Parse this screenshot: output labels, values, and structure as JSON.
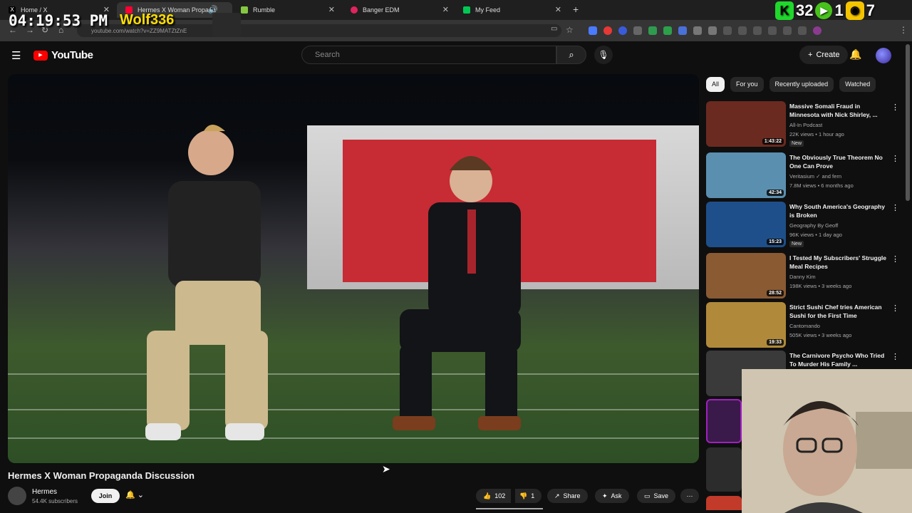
{
  "browser": {
    "tabs": [
      {
        "label": "Home / X",
        "color": "#000000",
        "glyph": "X"
      },
      {
        "label": "Hermes X Woman Propaga",
        "color": "#ff0033",
        "glyph": "▶"
      },
      {
        "label": "Rumble",
        "color": "#85c742",
        "glyph": "▶"
      },
      {
        "label": "Banger EDM",
        "color": "#e0245e",
        "glyph": "●"
      },
      {
        "label": "My Feed",
        "color": "#00c853",
        "glyph": "▶"
      }
    ],
    "url": "youtube.com/watch?v=ZZ9MATZtZnE"
  },
  "overlay": {
    "time": "04:19:53 PM",
    "username": "Wolf336",
    "kick_count": "32",
    "play_count": "1",
    "rumble_count": "7"
  },
  "header": {
    "logo_text": "YouTube",
    "search_placeholder": "Search",
    "create_label": "Create"
  },
  "video": {
    "title": "Hermes X Woman Propaganda Discussion",
    "channel": "Hermes",
    "subscribers": "54.4K subscribers",
    "join_label": "Join",
    "likes": "102",
    "dislikes": "1",
    "share_label": "Share",
    "ask_label": "Ask",
    "save_label": "Save"
  },
  "chips": [
    "All",
    "For you",
    "Recently uploaded",
    "Watched"
  ],
  "recommendations": [
    {
      "title": "Massive Somali Fraud in Minnesota with Nick Shirley, ...",
      "channel": "All-In Podcast",
      "meta": "22K views • 1 hour ago",
      "badge": "New",
      "duration": "1:43:22",
      "thumb": "#6b2a20"
    },
    {
      "title": "The Obviously True Theorem No One Can Prove",
      "channel": "Veritasium ✓ and fern",
      "meta": "7.8M views • 6 months ago",
      "badge": "",
      "duration": "42:34",
      "thumb": "#5b8fb0"
    },
    {
      "title": "Why South America's Geography is Broken",
      "channel": "Geography By Geoff",
      "meta": "96K views • 1 day ago",
      "badge": "New",
      "duration": "15:23",
      "thumb": "#1e4f8a"
    },
    {
      "title": "I Tested My Subscribers' Struggle Meal Recipes",
      "channel": "Danny Kim",
      "meta": "198K views • 3 weeks ago",
      "badge": "",
      "duration": "28:52",
      "thumb": "#8a5a33"
    },
    {
      "title": "Strict Sushi Chef tries American Sushi for the First Time",
      "channel": "Cantomando",
      "meta": "505K views • 3 weeks ago",
      "badge": "",
      "duration": "19:33",
      "thumb": "#b08a3a"
    },
    {
      "title": "The Carnivore Psycho Who Tried To Murder His Family ...",
      "channel": "",
      "meta": "",
      "badge": "",
      "duration": "",
      "thumb": "#3a3a3a"
    }
  ]
}
